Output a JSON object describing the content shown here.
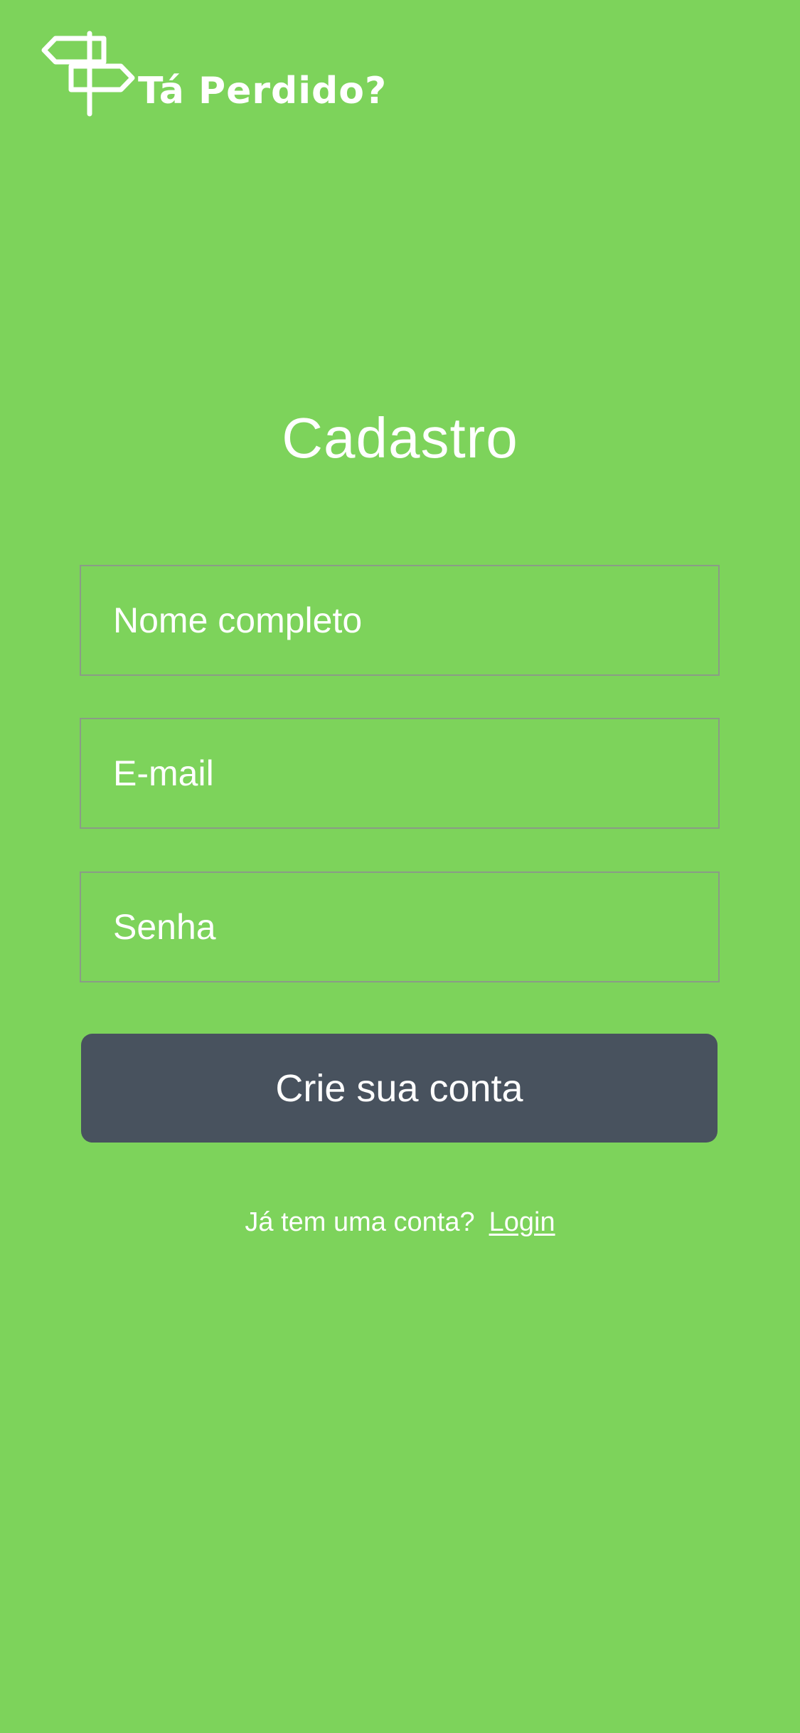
{
  "app": {
    "brand": "Tá Perdido?",
    "logo_icon": "signpost-icon"
  },
  "page": {
    "title": "Cadastro"
  },
  "form": {
    "name_placeholder": "Nome completo",
    "email_placeholder": "E-mail",
    "password_placeholder": "Senha",
    "submit_label": "Crie sua conta"
  },
  "footer": {
    "question": "Já tem uma conta?",
    "login_link": "Login"
  },
  "colors": {
    "background": "#7dd35b",
    "button": "#48525e",
    "field_border": "#8a9c86",
    "text": "#ffffff"
  }
}
